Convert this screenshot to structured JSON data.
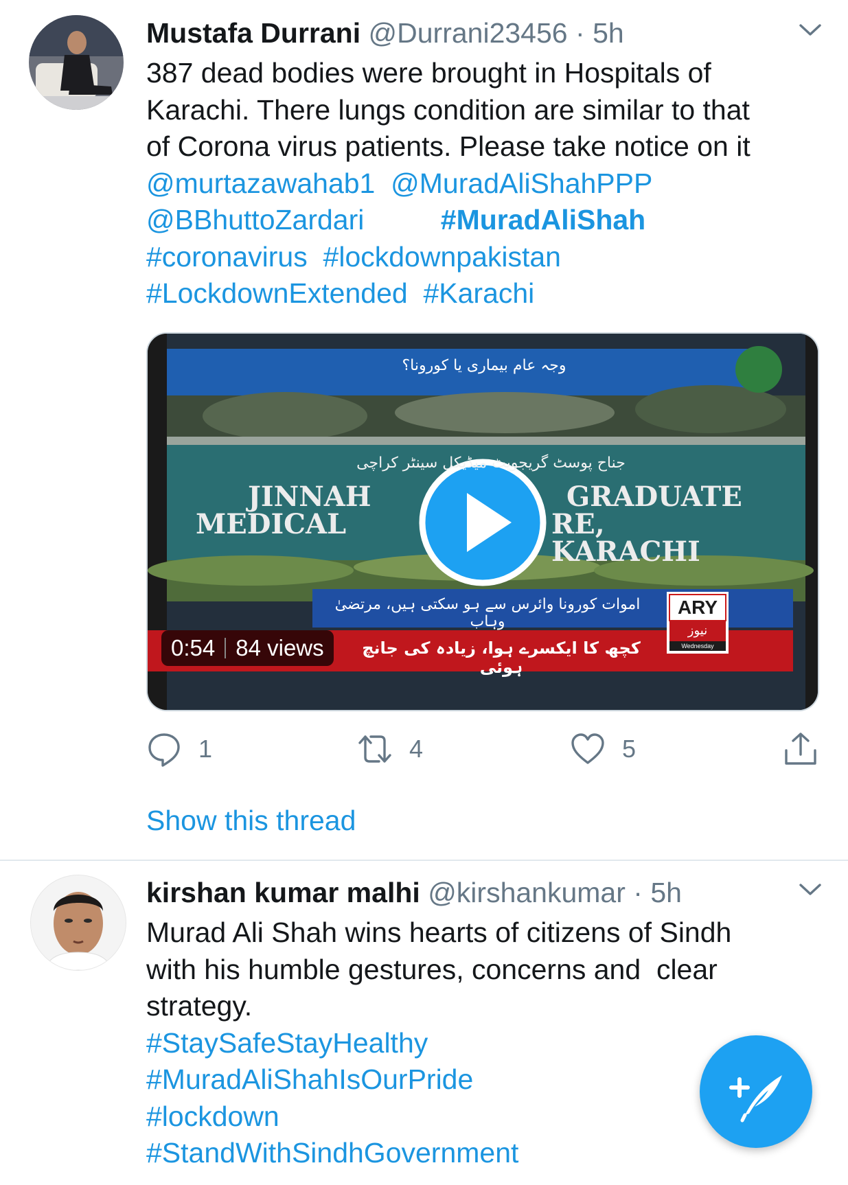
{
  "tweets": [
    {
      "name": "Mustafa Durrani",
      "handle": "@Durrani23456",
      "separator": "·",
      "time": "5h",
      "lines": [
        "387 dead bodies were brought in Hospitals of",
        "Karachi. There lungs condition are similar to that",
        "of Corona virus patients. Please take notice on it"
      ],
      "mentions": [
        "@murtazawahab1",
        "@MuradAliShahPPP",
        "@BBhuttoZardari"
      ],
      "hashtags": [
        "#MuradAliShah",
        "#coronavirus",
        "#lockdownpakistan",
        "#LockdownExtended",
        "#Karachi"
      ],
      "video": {
        "duration": "0:54",
        "views": "84 views",
        "headline_urdu": "وجہ عام بیماری یا کورونا؟",
        "sign_urdu": "جناح پوسٹ گریجویٹ میڈیکل سینٹر کراچی",
        "sign_line1_left": "JINNAH",
        "sign_line1_right": "GRADUATE",
        "sign_line2_left": "MEDICAL",
        "sign_line2_right": "RE, KARACHI",
        "ticker1_urdu": "اموات کورونا وائرس سے ہو سکتی ہیں، مرتضیٰ وہاب",
        "ticker2_urdu": "کچھ کا ایکسرے ہوا، زیادہ کی جانچ ہوئی",
        "channel": "ARY",
        "channel_sub": "نیوز",
        "day": "Wednesday"
      },
      "actions": {
        "replies": "1",
        "retweets": "4",
        "likes": "5"
      },
      "show_thread": "Show this thread"
    },
    {
      "name": "kirshan kumar malhi",
      "handle": "@kirshankumar",
      "separator": "·",
      "time": "5h",
      "lines": [
        "Murad Ali Shah wins hearts of citizens of Sindh",
        "with his humble gestures, concerns and  clear",
        "strategy."
      ],
      "hashtags": [
        "#StaySafeStayHealthy",
        "#MuradAliShahIsOurPride",
        "#lockdown",
        "#StandWithSindhGovernment"
      ]
    }
  ],
  "colors": {
    "link": "#1b95e0",
    "text": "#14171a",
    "meta": "#657786",
    "fab": "#1da1f2",
    "play": "#1da1f2"
  },
  "icons": {
    "reply": "reply-icon",
    "retweet": "retweet-icon",
    "like": "heart-icon",
    "share": "share-icon",
    "compose": "compose-tweet-icon",
    "caret": "chevron-down-icon",
    "play": "play-icon"
  }
}
